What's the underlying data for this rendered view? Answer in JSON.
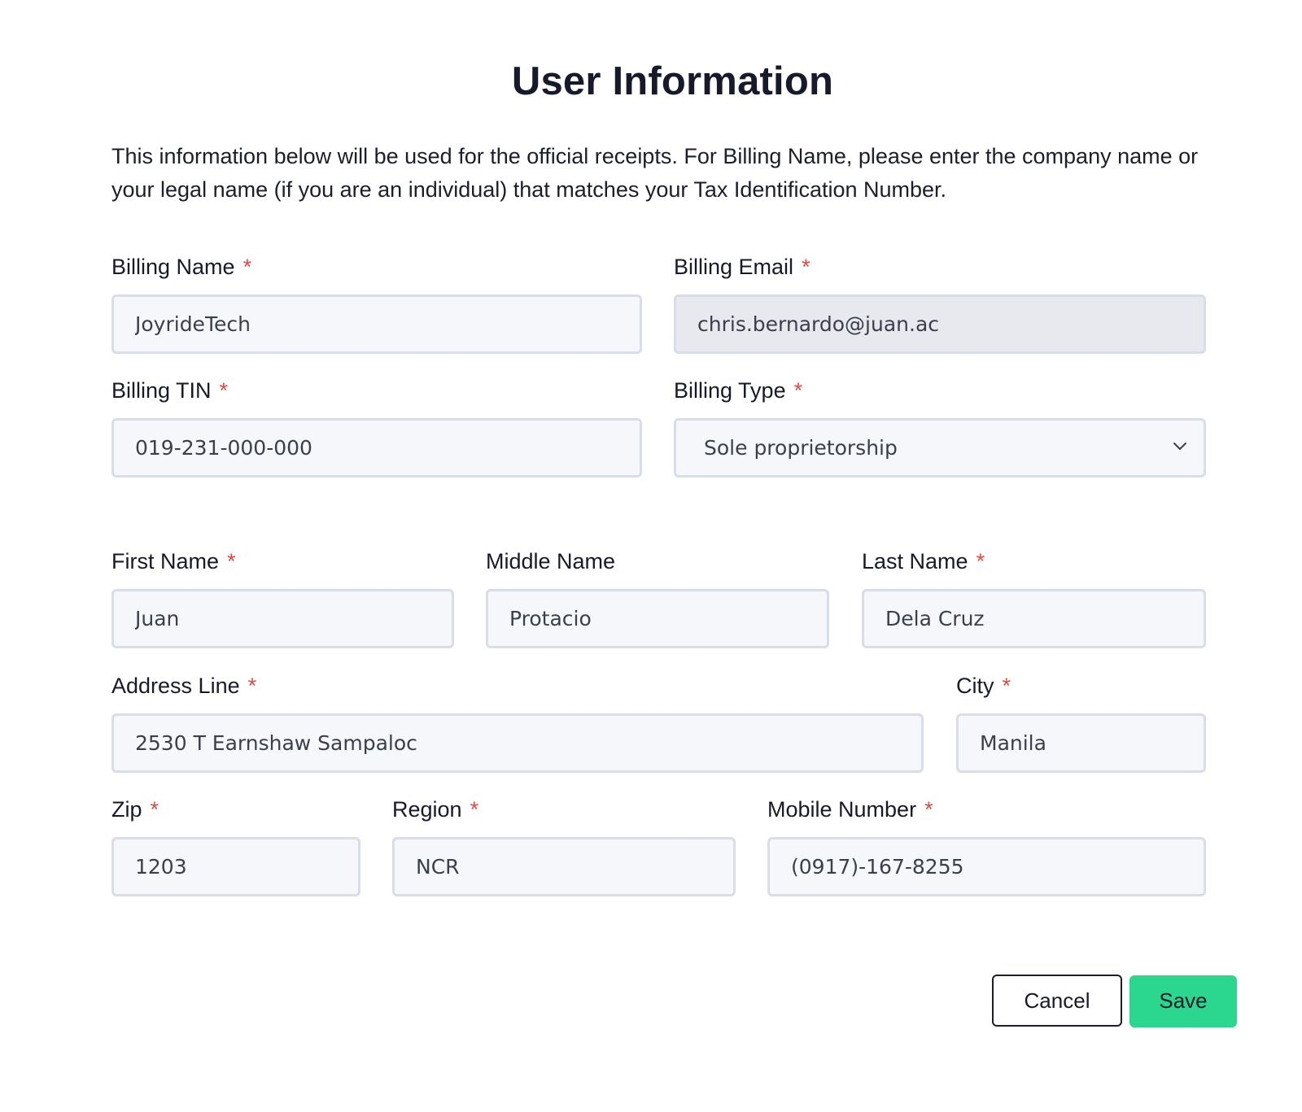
{
  "title": "User Information",
  "intro": "This information below will be used for the official receipts. For Billing Name, please enter the company name or your legal name (if you are an individual) that matches your Tax Identification Number.",
  "required_mark": "*",
  "fields": {
    "billing_name": {
      "label": "Billing Name",
      "value": "JoyrideTech",
      "required": true
    },
    "billing_email": {
      "label": "Billing Email",
      "value": "chris.bernardo@juan.ac",
      "required": true,
      "readonly": true
    },
    "billing_tin": {
      "label": "Billing TIN",
      "value": "019-231-000-000",
      "required": true
    },
    "billing_type": {
      "label": "Billing Type",
      "value": "Sole proprietorship",
      "required": true
    },
    "first_name": {
      "label": "First Name",
      "value": "Juan",
      "required": true
    },
    "middle_name": {
      "label": "Middle Name",
      "value": "Protacio",
      "required": false
    },
    "last_name": {
      "label": "Last Name",
      "value": "Dela Cruz",
      "required": true
    },
    "address_line": {
      "label": "Address Line",
      "value": "2530 T Earnshaw Sampaloc",
      "required": true
    },
    "city": {
      "label": "City",
      "value": "Manila",
      "required": true
    },
    "zip": {
      "label": "Zip",
      "value": "1203",
      "required": true
    },
    "region": {
      "label": "Region",
      "value": "NCR",
      "required": true
    },
    "mobile_number": {
      "label": "Mobile Number",
      "value": "(0917)-167-8255",
      "required": true
    }
  },
  "actions": {
    "cancel_label": "Cancel",
    "save_label": "Save"
  },
  "colors": {
    "required": "#e04a44",
    "save_button": "#2bd68f",
    "input_background": "#f6f7fb",
    "input_readonly_background": "#e8e9ee",
    "input_border": "#d9dde8"
  },
  "icons": {
    "select_arrow": "chevron-down-icon"
  }
}
